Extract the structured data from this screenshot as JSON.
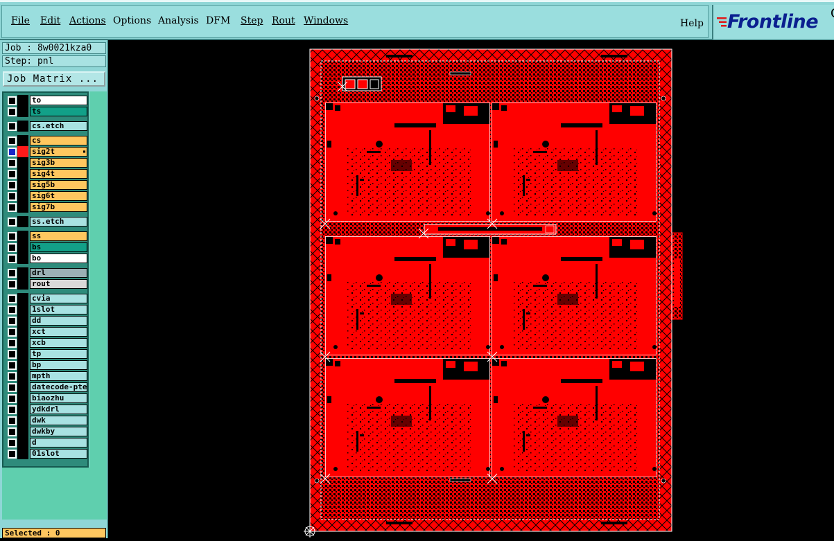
{
  "menu": {
    "items": [
      {
        "label": "File"
      },
      {
        "label": "Edit"
      },
      {
        "label": "Actions"
      },
      {
        "label": "Options"
      },
      {
        "label": "Analysis"
      },
      {
        "label": "DFM"
      },
      {
        "label": "Step"
      },
      {
        "label": "Rout"
      },
      {
        "label": "Windows"
      }
    ],
    "help": "Help"
  },
  "brand": {
    "name": "Frontline",
    "corner": "C"
  },
  "job": {
    "job_text": "Job : 8w0021kza0",
    "step_text": "Step: pnl"
  },
  "job_matrix_label": "Job Matrix ...",
  "layers": [
    {
      "name": "to",
      "color": "#ffffff"
    },
    {
      "name": "ts",
      "color": "#12a088"
    },
    {
      "name": "cs.etch",
      "color": "#a8e2e2"
    },
    {
      "name": "cs",
      "color": "#ffc75f"
    },
    {
      "name": "sig2t",
      "color": "#ffc75f"
    },
    {
      "name": "sig3b",
      "color": "#ffc75f"
    },
    {
      "name": "sig4t",
      "color": "#ffc75f"
    },
    {
      "name": "sig5b",
      "color": "#ffc75f"
    },
    {
      "name": "sig6t",
      "color": "#ffc75f"
    },
    {
      "name": "sig7b",
      "color": "#ffc75f"
    },
    {
      "name": "ss.etch",
      "color": "#a8e2e2"
    },
    {
      "name": "ss",
      "color": "#ffc75f"
    },
    {
      "name": "bs",
      "color": "#12a088"
    },
    {
      "name": "bo",
      "color": "#ffffff"
    },
    {
      "name": "drl",
      "color": "#9bb0b5"
    },
    {
      "name": "rout",
      "color": "#d9d9d9"
    },
    {
      "name": "cvia",
      "color": "#a8e2e2"
    },
    {
      "name": "1slot",
      "color": "#a8e2e2"
    },
    {
      "name": "dd",
      "color": "#a8e2e2"
    },
    {
      "name": "xct",
      "color": "#a8e2e2"
    },
    {
      "name": "xcb",
      "color": "#a8e2e2"
    },
    {
      "name": "tp",
      "color": "#a8e2e2"
    },
    {
      "name": "bp",
      "color": "#a8e2e2"
    },
    {
      "name": "mpth",
      "color": "#a8e2e2"
    },
    {
      "name": "datecode-pte",
      "color": "#a8e2e2"
    },
    {
      "name": "biaozhu",
      "color": "#a8e2e2"
    },
    {
      "name": "ydkdrl",
      "color": "#a8e2e2"
    },
    {
      "name": "dwk",
      "color": "#a8e2e2"
    },
    {
      "name": "dwkby",
      "color": "#a8e2e2"
    },
    {
      "name": "d",
      "color": "#a8e2e2"
    },
    {
      "name": "01slot",
      "color": "#a8e2e2"
    }
  ],
  "status": "Selected : 0",
  "colors": {
    "accent": "#8fd6d6",
    "board": "#ff0000",
    "copper_bg": "#000000"
  }
}
